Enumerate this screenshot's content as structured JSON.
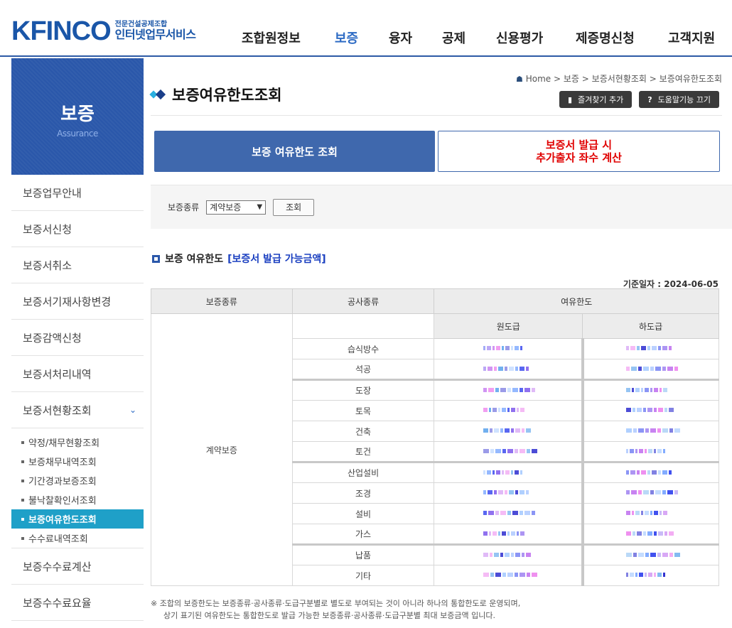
{
  "header": {
    "logo_text": "KFINCO",
    "logo_small": "전문건설공제조합",
    "logo_big": "인터넷업무서비스",
    "nav": [
      "조합원정보",
      "보증",
      "융자",
      "공제",
      "신용평가",
      "제증명신청",
      "고객지원"
    ]
  },
  "sidebar": {
    "title": "보증",
    "subtitle": "Assurance",
    "items": [
      "보증업무안내",
      "보증서신청",
      "보증서취소",
      "보증서기재사항변경",
      "보증감액신청",
      "보증서처리내역",
      "보증서현황조회"
    ],
    "subitems": [
      "약정/채무현황조회",
      "보증채무내역조회",
      "기간경과보증조회",
      "불낙찰확인서조회",
      "보증여유한도조회",
      "수수료내역조회"
    ],
    "after_items": [
      "보증수수료계산",
      "보증수수료요율"
    ]
  },
  "breadcrumb": {
    "home": "Home",
    "sep": ">",
    "b1": "보증",
    "b2": "보증서현황조회",
    "b3": "보증여유한도조회"
  },
  "page": {
    "title": "보증여유한도조회",
    "btn_favorite": "즐겨찾기 추가",
    "btn_help": "도움말기능 끄기"
  },
  "tabs": {
    "tab1": "보증 여유한도 조회",
    "tab2": "보증서  발급  시\n추가출자  좌수  계산"
  },
  "search": {
    "label": "보증종류",
    "selected": "계약보증",
    "button": "조회"
  },
  "section": {
    "title": "보증 여유한도",
    "title_blue": "[보증서 발급 가능금액]",
    "base_date": "기준일자 : 2024-06-05"
  },
  "table": {
    "headers": {
      "type": "보증종류",
      "work": "공사종류",
      "limit": "여유한도",
      "prime": "원도급",
      "sub": "하도급"
    },
    "type_value": "계약보증",
    "rows": [
      "습식방수",
      "석공",
      "도장",
      "토목",
      "건축",
      "토건",
      "산업설비",
      "조경",
      "설비",
      "가스",
      "납품",
      "기타"
    ]
  },
  "note": {
    "l1": "※ 조합의 보증한도는 보증종류·공사종류·도급구분별로 별도로 부여되는 것이 아니라 하나의 통합한도로 운영되며,",
    "l2": "상기 표기된 여유한도는 통합한도로 발급 가능한 보증종류·공사종류·도급구분별 최대 보증금액 입니다."
  },
  "colors": {
    "brand": "#2a57aa",
    "active_sub": "#1fa0c8",
    "tab_alert": "#e00000"
  }
}
